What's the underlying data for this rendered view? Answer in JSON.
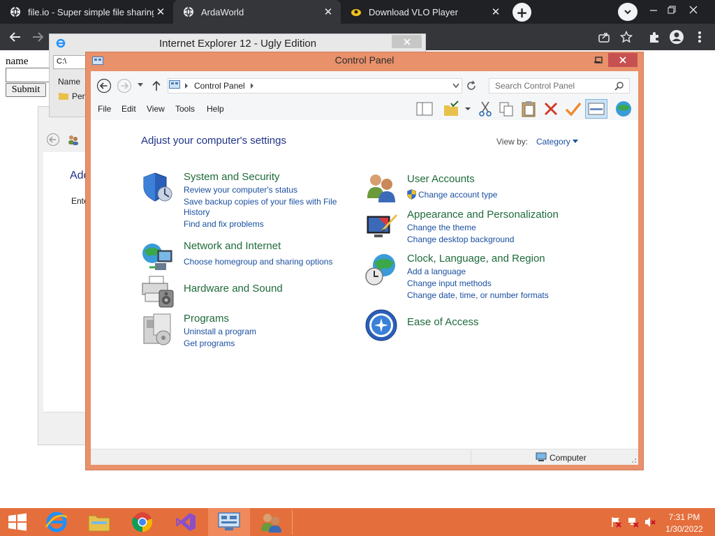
{
  "browser": {
    "tabs": [
      {
        "label": "file.io - Super simple file sharing",
        "active": false
      },
      {
        "label": "ArdaWorld",
        "active": true
      },
      {
        "label": "Download VLO Player",
        "active": false
      }
    ],
    "tab_close_glyph": "✕",
    "new_tab_glyph": "+"
  },
  "page_form": {
    "label": "name",
    "submit_label": "Submit"
  },
  "ie_window": {
    "title": "Internet Explorer 12 - Ugly Edition",
    "address": "C:\\",
    "column_name": "Name",
    "row_text": "Perf"
  },
  "ua_window": {
    "heading": "Add",
    "text": "Ente"
  },
  "control_panel": {
    "title": "Control Panel",
    "breadcrumb": "Control Panel",
    "search_placeholder": "Search Control Panel",
    "menu": [
      "File",
      "Edit",
      "View",
      "Tools",
      "Help"
    ],
    "heading": "Adjust your computer's settings",
    "view_by_label": "View by:",
    "view_by_value": "Category",
    "status_text": "Computer",
    "categories_left": [
      {
        "title": "System and Security",
        "icon": "shield-icon",
        "links": [
          "Review your computer's status",
          "Save backup copies of your files with File",
          "History",
          "Find and fix problems"
        ]
      },
      {
        "title": "Network and Internet",
        "icon": "network-icon",
        "links": [
          "Choose homegroup and sharing options"
        ]
      },
      {
        "title": "Hardware and Sound",
        "icon": "printer-icon",
        "links": []
      },
      {
        "title": "Programs",
        "icon": "programs-icon",
        "links": [
          "Uninstall a program",
          "Get programs"
        ]
      }
    ],
    "categories_right": [
      {
        "title": "User Accounts",
        "icon": "users-icon",
        "links": [
          "Change account type"
        ]
      },
      {
        "title": "Appearance and Personalization",
        "icon": "appearance-icon",
        "links": [
          "Change the theme",
          "Change desktop background"
        ]
      },
      {
        "title": "Clock, Language, and Region",
        "icon": "globe-clock-icon",
        "links": [
          "Add a language",
          "Change input methods",
          "Change date, time, or number formats"
        ]
      },
      {
        "title": "Ease of Access",
        "icon": "ease-of-access-icon",
        "links": []
      }
    ]
  },
  "taskbar": {
    "time": "7:31 PM",
    "date": "1/30/2022",
    "buttons": [
      "start-button",
      "ie-taskbar-button",
      "explorer-taskbar-button",
      "chrome-taskbar-button",
      "visual-studio-taskbar-button",
      "control-panel-taskbar-button",
      "user-accounts-taskbar-button"
    ]
  },
  "colors": {
    "taskbar": "#e46f3c",
    "window_frame": "#e8916b",
    "close_button": "#c75050",
    "link": "#1a4fa0",
    "category": "#1e6a3a",
    "chrome_dark": "#202124"
  }
}
